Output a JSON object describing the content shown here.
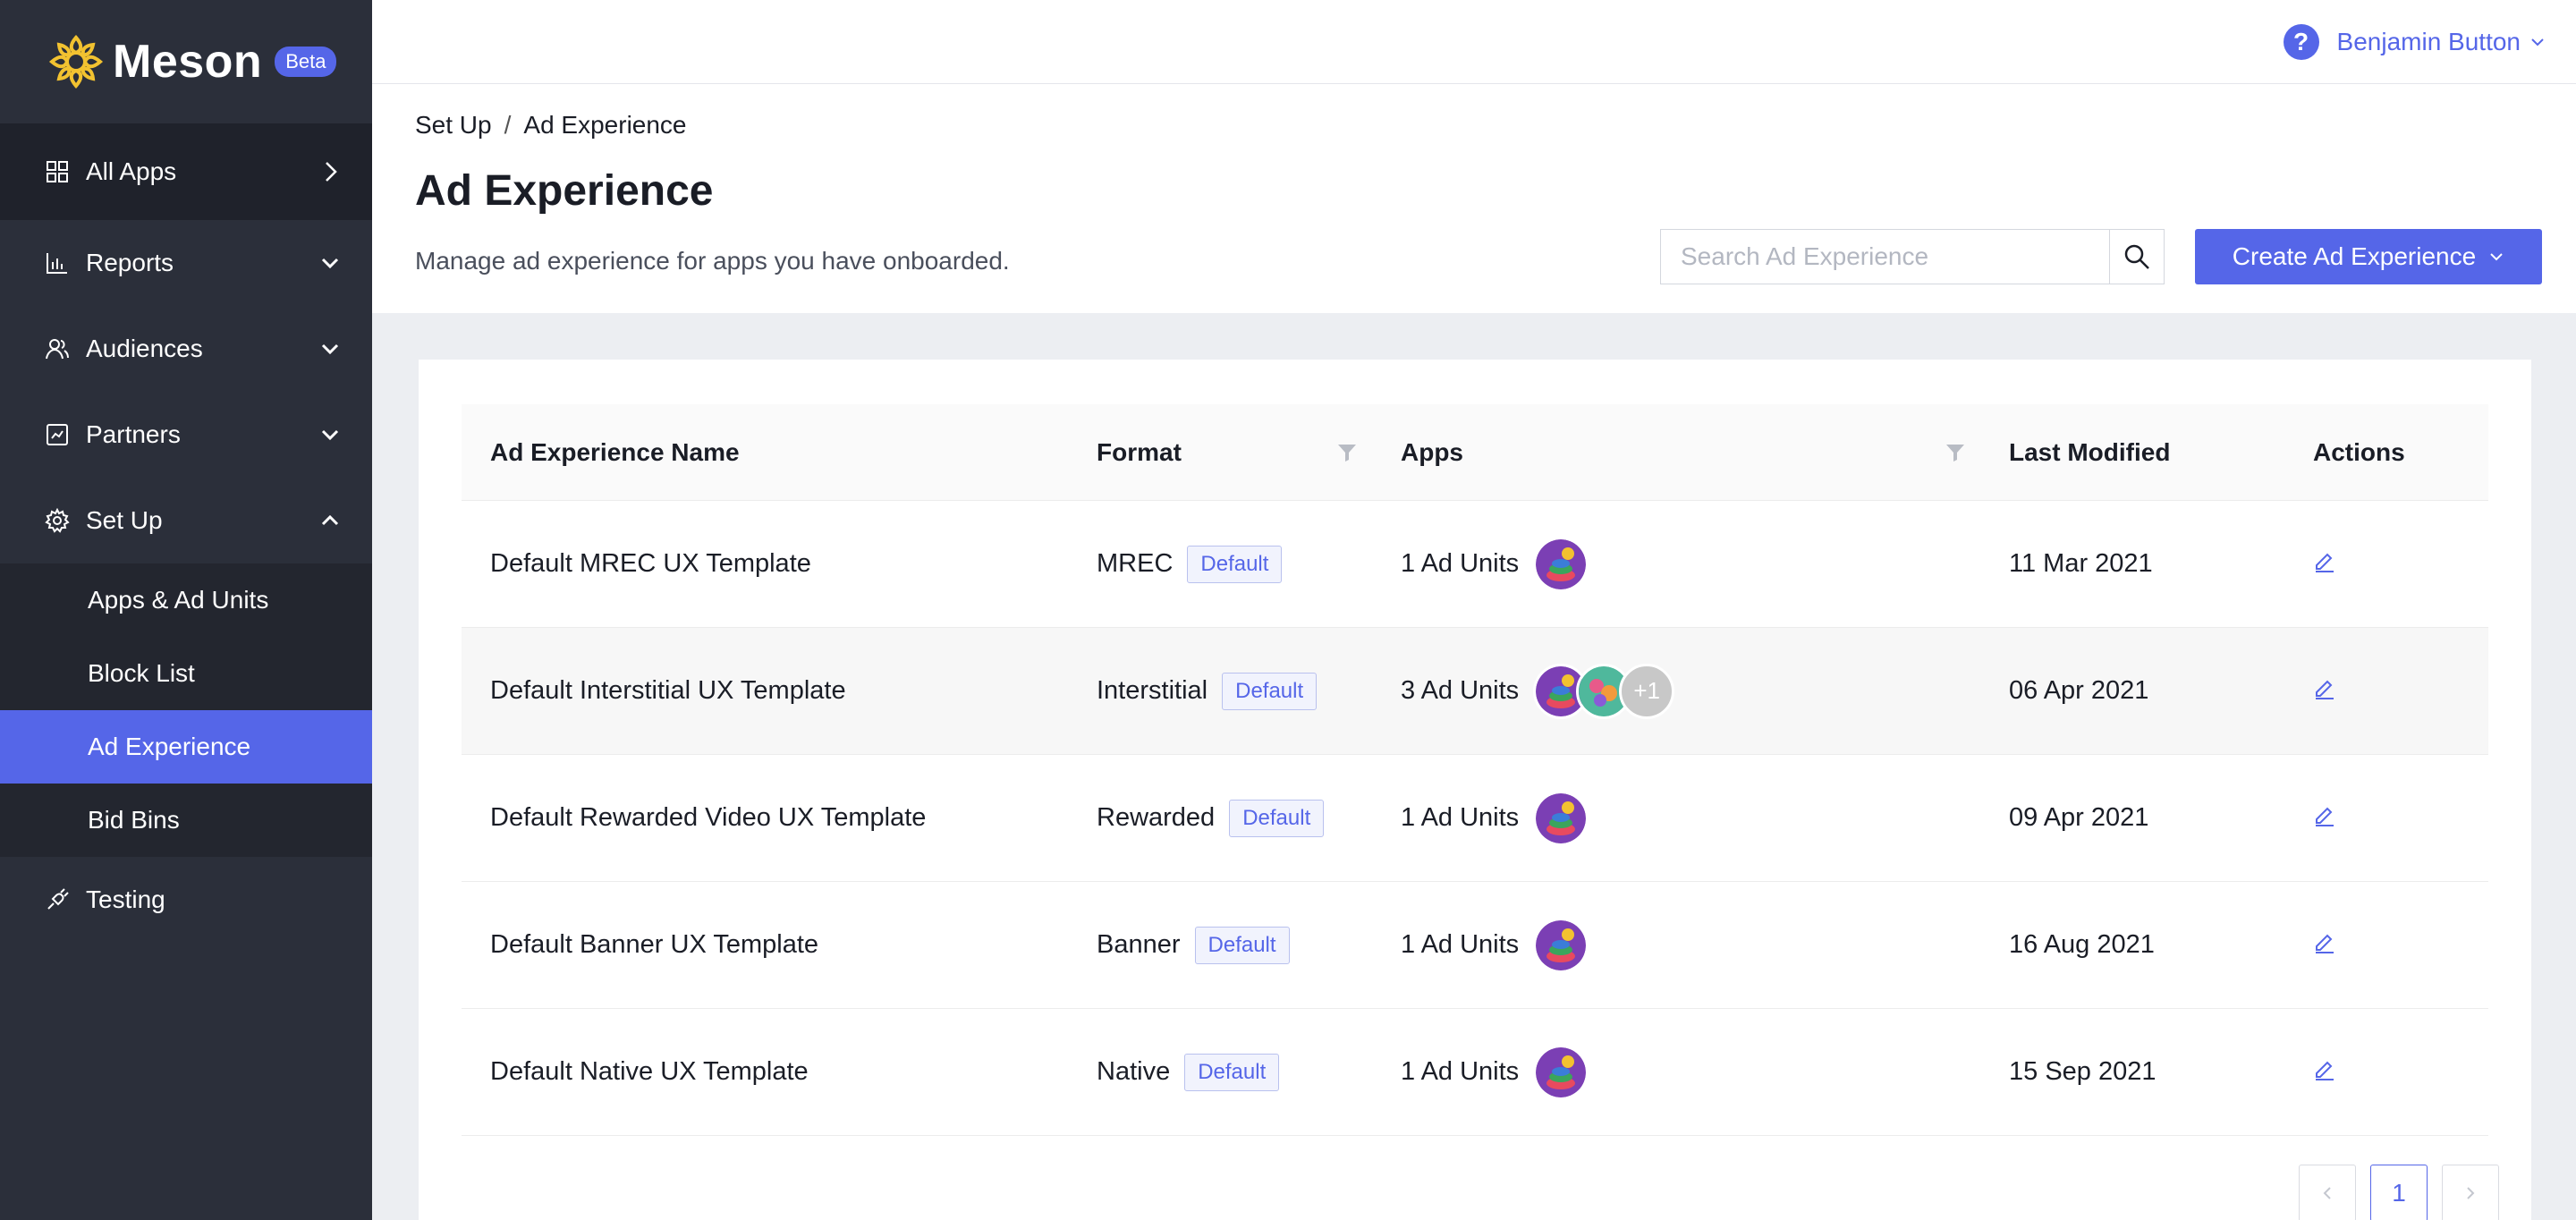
{
  "brand": {
    "name": "Meson",
    "badge": "Beta",
    "accent": "#5566e8"
  },
  "sidebar": {
    "all_apps": "All Apps",
    "items": [
      {
        "label": "Reports",
        "icon": "bar-chart-icon"
      },
      {
        "label": "Audiences",
        "icon": "users-icon"
      },
      {
        "label": "Partners",
        "icon": "partners-icon"
      },
      {
        "label": "Set Up",
        "icon": "gear-icon"
      }
    ],
    "setup_children": [
      "Apps & Ad Units",
      "Block List",
      "Ad Experience",
      "Bid Bins"
    ],
    "testing": "Testing"
  },
  "topbar": {
    "help": "?",
    "user": "Benjamin Button"
  },
  "breadcrumb": {
    "parent": "Set Up",
    "sep": "/",
    "current": "Ad Experience"
  },
  "page": {
    "title": "Ad Experience",
    "subtitle": "Manage ad experience for apps you have onboarded.",
    "search_placeholder": "Search Ad Experience",
    "create_label": "Create Ad Experience"
  },
  "table": {
    "headers": {
      "name": "Ad Experience Name",
      "format": "Format",
      "apps": "Apps",
      "modified": "Last Modified",
      "actions": "Actions"
    },
    "rows": [
      {
        "name": "Default MREC UX Template",
        "format": "MREC",
        "tag": "Default",
        "apps": "1 Ad Units",
        "modified": "11 Mar 2021"
      },
      {
        "name": "Default Interstitial UX Template",
        "format": "Interstitial",
        "tag": "Default",
        "apps": "3 Ad Units",
        "more": "+1",
        "modified": "06 Apr 2021"
      },
      {
        "name": "Default Rewarded Video UX Template",
        "format": "Rewarded",
        "tag": "Default",
        "apps": "1 Ad Units",
        "modified": "09 Apr 2021"
      },
      {
        "name": "Default Banner UX Template",
        "format": "Banner",
        "tag": "Default",
        "apps": "1 Ad Units",
        "modified": "16 Aug 2021"
      },
      {
        "name": "Default Native UX Template",
        "format": "Native",
        "tag": "Default",
        "apps": "1 Ad Units",
        "modified": "15 Sep 2021"
      }
    ]
  },
  "pagination": {
    "current": "1"
  }
}
